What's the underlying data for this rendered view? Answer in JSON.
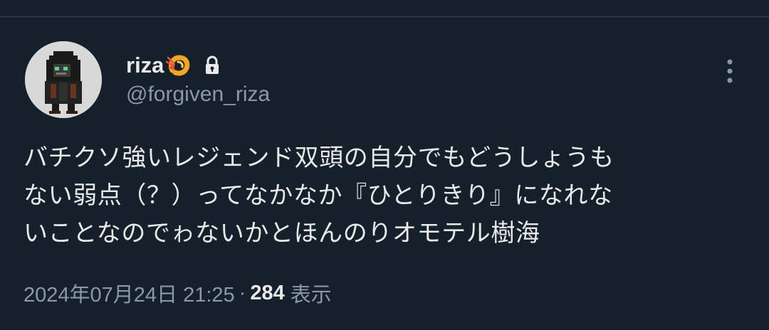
{
  "tweet": {
    "author": {
      "display_name": "riza",
      "handle": "@forgiven_riza",
      "emoji_icon": "shrimp-icon",
      "protected_icon": "lock-icon",
      "avatar_icon": "pixel-art-hooded-figure-avatar"
    },
    "more_icon": "more-vertical-icon",
    "text_lines": [
      "バチクソ強いレジェンド双頭の自分でもどうしょうも",
      "ない弱点（？）ってなかなか『ひとりきり』になれな",
      "いことなのでゎないかとほんのりオモテル樹海"
    ],
    "timestamp": "2024年07月24日 21:25",
    "separator": "·",
    "views_count": "284",
    "views_label": "表示"
  },
  "colors": {
    "background": "#15202b",
    "divider": "#38444d",
    "primary_text": "#e7e9ea",
    "secondary_text": "#8b98a5"
  }
}
